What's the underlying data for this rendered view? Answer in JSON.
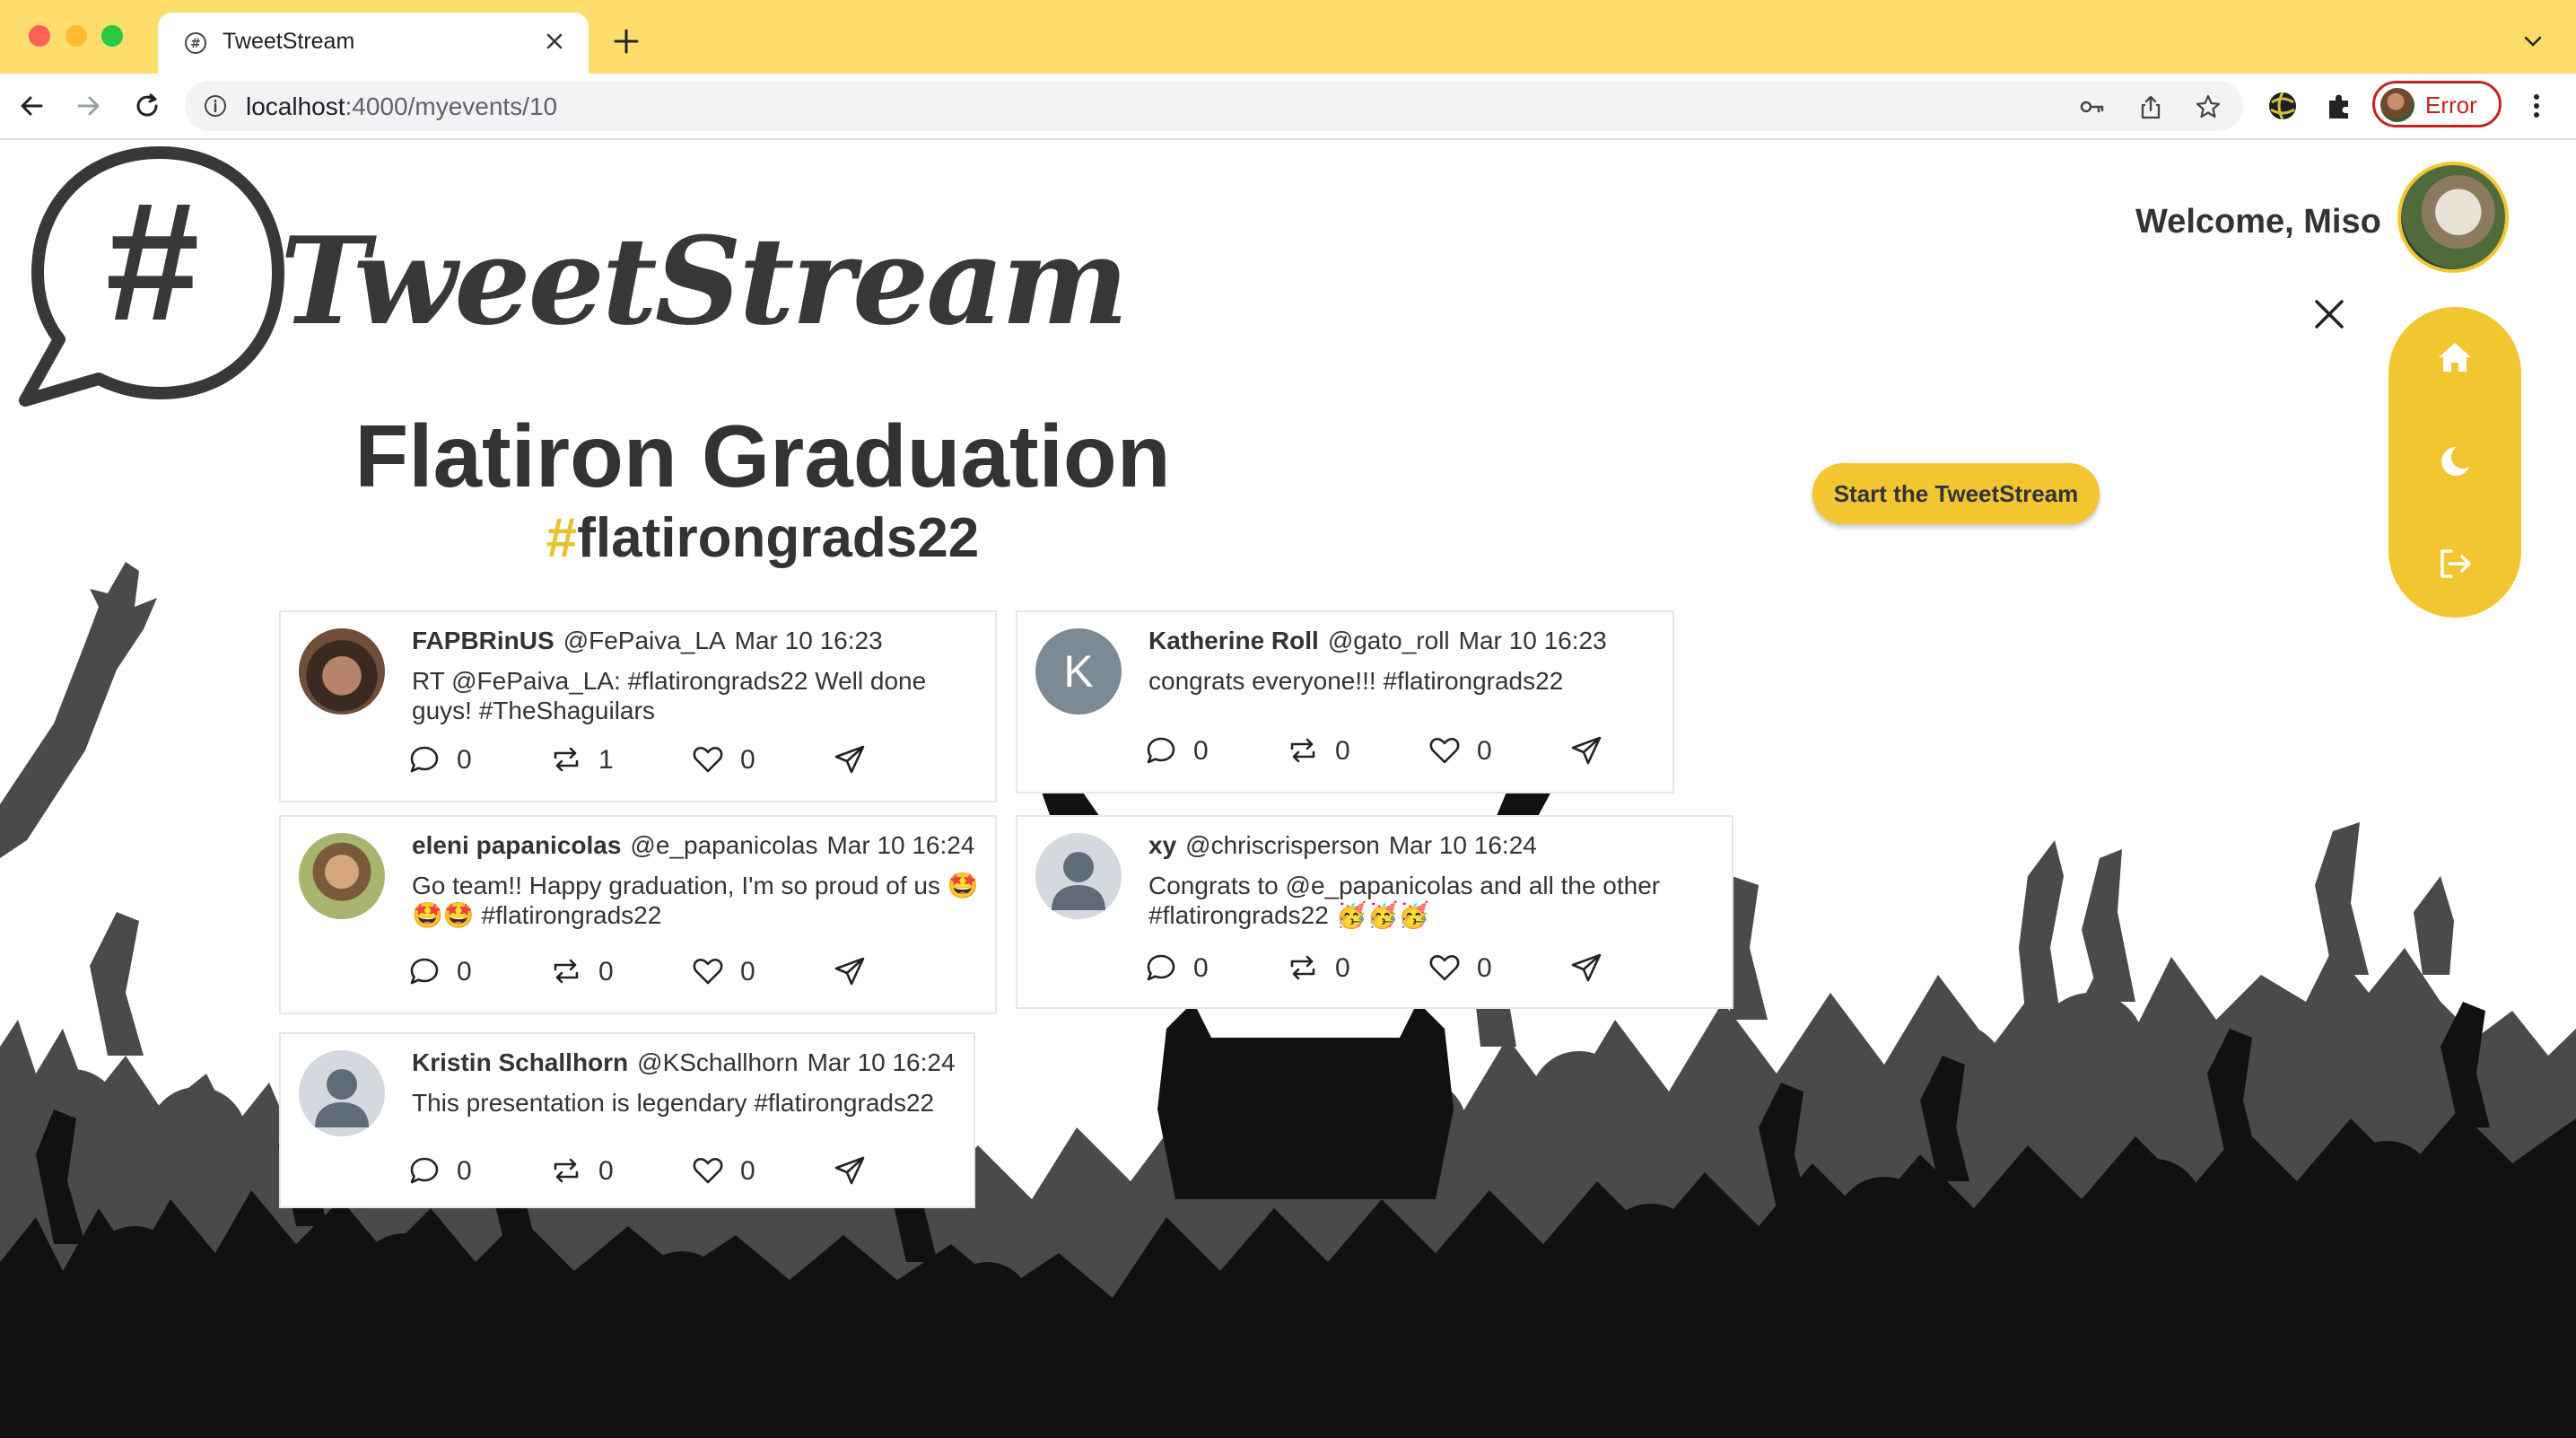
{
  "browser": {
    "tab_title": "TweetStream",
    "url_host": "localhost",
    "url_rest": ":4000/myevents/10",
    "profile_label": "Error"
  },
  "header": {
    "logo_text": "TweetStream",
    "welcome": "Welcome, Miso"
  },
  "event": {
    "title": "Flatiron Graduation",
    "hashtag_symbol": "#",
    "hashtag_text": "flatirongrads22"
  },
  "start_button": "Start the TweetStream",
  "nav": {
    "items": [
      {
        "icon": "home-icon"
      },
      {
        "icon": "moon-icon"
      },
      {
        "icon": "logout-icon"
      }
    ]
  },
  "tweets": [
    {
      "name": "FAPBRinUS",
      "handle": "@FePaiva_LA",
      "time": "Mar 10 16:23",
      "text_line1": "RT @FePaiva_LA: #flatirongrads22 Well done",
      "text_line2": "guys! #TheShaguilars",
      "replies": "0",
      "retweets": "1",
      "likes": "0"
    },
    {
      "name": "Katherine Roll",
      "handle": "@gato_roll",
      "time": "Mar 10 16:23",
      "avatar_letter": "K",
      "text_line1": "congrats everyone!!! #flatirongrads22",
      "text_line2": "",
      "replies": "0",
      "retweets": "0",
      "likes": "0"
    },
    {
      "name": "eleni papanicolas",
      "handle": "@e_papanicolas",
      "time": "Mar 10 16:24",
      "text_line1": "Go team!! Happy graduation, I'm so proud of us 🤩",
      "text_line2": "🤩🤩 #flatirongrads22",
      "replies": "0",
      "retweets": "0",
      "likes": "0"
    },
    {
      "name": "xy",
      "handle": "@chriscrisperson",
      "time": "Mar 10 16:24",
      "text_line1": "Congrats to @e_papanicolas and all the other",
      "text_line2": "#flatirongrads22 🥳🥳🥳",
      "replies": "0",
      "retweets": "0",
      "likes": "0"
    },
    {
      "name": "Kristin Schallhorn",
      "handle": "@KSchallhorn",
      "time": "Mar 10 16:24",
      "text_line1": "This presentation is legendary #flatirongrads22",
      "text_line2": "",
      "replies": "0",
      "retweets": "0",
      "likes": "0"
    }
  ],
  "colors": {
    "accent": "#f2c631",
    "browser_frame": "#fddd6c",
    "text": "#333333",
    "crowd_dark": "#111111",
    "crowd_mid": "#4a4a4a"
  }
}
